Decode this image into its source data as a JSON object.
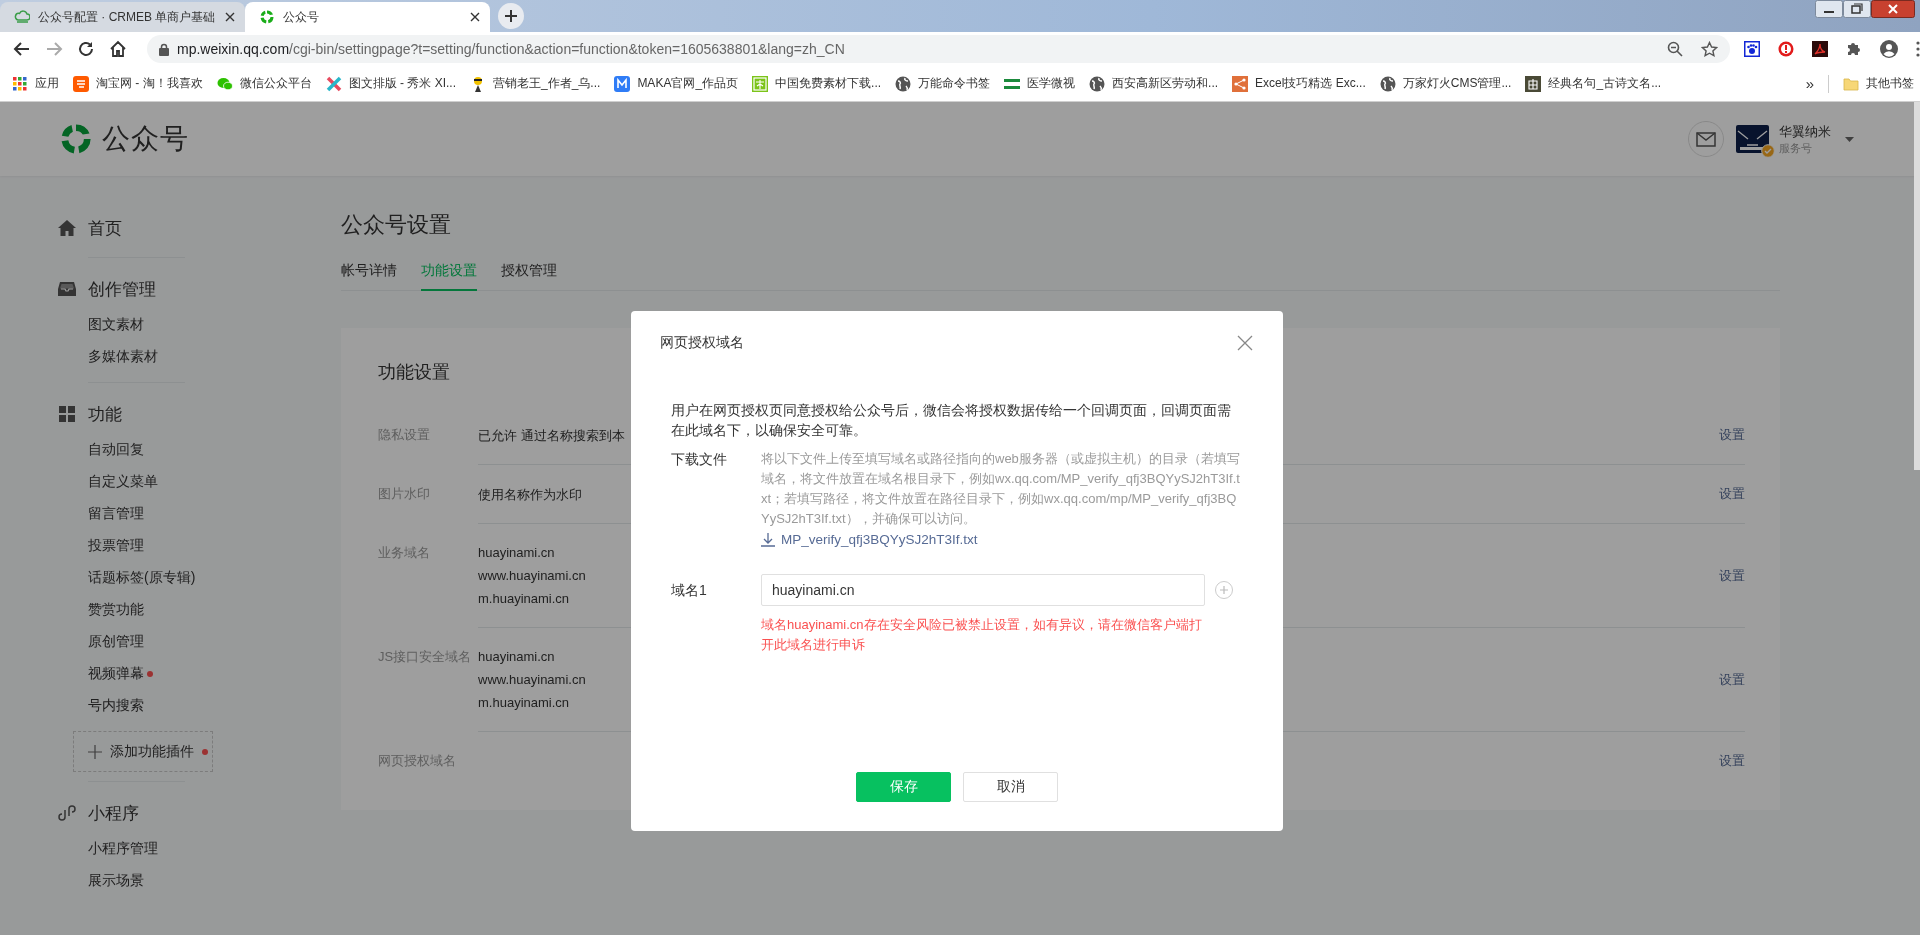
{
  "browser": {
    "tabs": [
      {
        "title": "公众号配置 · CRMEB 单商户基础",
        "selected": false
      },
      {
        "title": "公众号",
        "selected": true
      }
    ],
    "address": {
      "host": "mp.weixin.qq.com",
      "path": "/cgi-bin/settingpage?t=setting/function&action=function&token=1605638801&lang=zh_CN"
    },
    "bookmarks": [
      {
        "label": "应用"
      },
      {
        "label": "淘宝网 - 淘！我喜欢"
      },
      {
        "label": "微信公众平台"
      },
      {
        "label": "图文排版 - 秀米 XI..."
      },
      {
        "label": "营销老王_作者_乌..."
      },
      {
        "label": "MAKA官网_作品页"
      },
      {
        "label": "中国免费素材下载..."
      },
      {
        "label": "万能命令书签"
      },
      {
        "label": "医学微视"
      },
      {
        "label": "西安高新区劳动和..."
      },
      {
        "label": "Excel技巧精选 Exc..."
      },
      {
        "label": "万家灯火CMS管理..."
      },
      {
        "label": "经典名句_古诗文名..."
      }
    ],
    "overflow": "»",
    "other_bookmarks": "其他书签"
  },
  "header": {
    "logo_text": "公众号",
    "account_name": "华翼纳米",
    "account_type": "服务号",
    "verified": true
  },
  "sidebar": {
    "sections": [
      {
        "title": "首页"
      },
      {
        "title": "创作管理",
        "items": [
          {
            "label": "图文素材",
            "dot": false
          },
          {
            "label": "多媒体素材",
            "dot": false
          }
        ]
      },
      {
        "title": "功能",
        "items": [
          {
            "label": "自动回复",
            "dot": false
          },
          {
            "label": "自定义菜单",
            "dot": false
          },
          {
            "label": "留言管理",
            "dot": false
          },
          {
            "label": "投票管理",
            "dot": false
          },
          {
            "label": "话题标签(原专辑)",
            "dot": false
          },
          {
            "label": "赞赏功能",
            "dot": false
          },
          {
            "label": "原创管理",
            "dot": false
          },
          {
            "label": "视频弹幕",
            "dot": true
          },
          {
            "label": "号内搜索",
            "dot": false
          }
        ],
        "add_plugin": {
          "label": "添加功能插件",
          "dot": true
        }
      },
      {
        "title": "小程序",
        "items": [
          {
            "label": "小程序管理",
            "dot": false
          },
          {
            "label": "展示场景",
            "dot": false
          }
        ]
      }
    ]
  },
  "content": {
    "title": "公众号设置",
    "tabs": [
      {
        "label": "帐号详情",
        "selected": false
      },
      {
        "label": "功能设置",
        "selected": true
      },
      {
        "label": "授权管理",
        "selected": false
      }
    ],
    "card": {
      "title": "功能设置",
      "rows": [
        {
          "label": "隐私设置",
          "values": [
            "已允许 通过名称搜索到本"
          ],
          "action": "设置"
        },
        {
          "label": "图片水印",
          "values": [
            "使用名称作为水印"
          ],
          "action": "设置"
        },
        {
          "label": "业务域名",
          "values": [
            "huayinami.cn",
            "www.huayinami.cn",
            "m.huayinami.cn"
          ],
          "action": "设置"
        },
        {
          "label": "JS接口安全域名",
          "values": [
            "huayinami.cn",
            "www.huayinami.cn",
            "m.huayinami.cn"
          ],
          "action": "设置"
        },
        {
          "label": "网页授权域名",
          "action": "设置"
        }
      ]
    }
  },
  "dialog": {
    "title": "网页授权域名",
    "description": "用户在网页授权页同意授权给公众号后，微信会将授权数据传给一个回调页面，回调页面需在此域名下，以确保安全可靠。",
    "download_label": "下载文件",
    "download_hint": "将以下文件上传至填写域名或路径指向的web服务器（或虚拟主机）的目录（若填写域名，将文件放置在域名根目录下，例如wx.qq.com/MP_verify_qfj3BQYySJ2hT3If.txt；若填写路径，将文件放置在路径目录下，例如wx.qq.com/mp/MP_verify_qfj3BQYySJ2hT3If.txt），并确保可以访问。",
    "download_file": "MP_verify_qfj3BQYySJ2hT3If.txt",
    "domains": [
      {
        "label": "域名1",
        "value": "huayinami.cn",
        "error": "域名huayinami.cn存在安全风险已被禁止设置，如有异议，请在微信客户端打开此域名进行申诉"
      }
    ],
    "buttons": [
      {
        "label": "保存",
        "kind": "primary"
      },
      {
        "label": "取消",
        "kind": "default"
      }
    ]
  }
}
